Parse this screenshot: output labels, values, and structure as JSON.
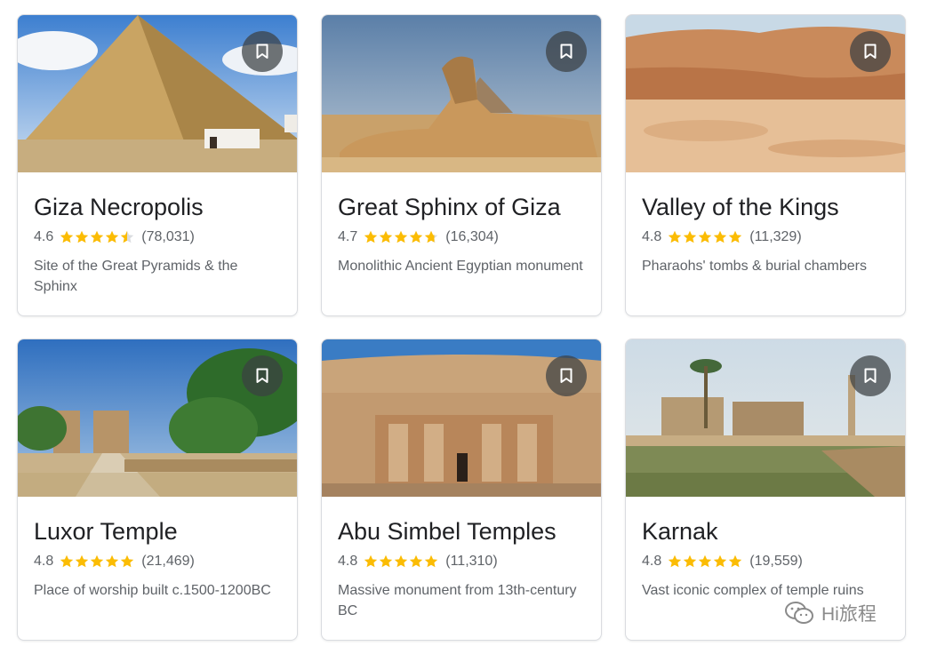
{
  "cards": [
    {
      "title": "Giza Necropolis",
      "rating": "4.6",
      "reviews": "(78,031)",
      "description": "Site of the Great Pyramids & the Sphinx",
      "stars": [
        1,
        1,
        1,
        1,
        0.5
      ]
    },
    {
      "title": "Great Sphinx of Giza",
      "rating": "4.7",
      "reviews": "(16,304)",
      "description": "Monolithic Ancient Egyptian monument",
      "stars": [
        1,
        1,
        1,
        1,
        0.75
      ]
    },
    {
      "title": "Valley of the Kings",
      "rating": "4.8",
      "reviews": "(11,329)",
      "description": "Pharaohs' tombs & burial chambers",
      "stars": [
        1,
        1,
        1,
        1,
        1
      ]
    },
    {
      "title": "Luxor Temple",
      "rating": "4.8",
      "reviews": "(21,469)",
      "description": "Place of worship built c.1500-1200BC",
      "stars": [
        1,
        1,
        1,
        1,
        1
      ]
    },
    {
      "title": "Abu Simbel Temples",
      "rating": "4.8",
      "reviews": "(11,310)",
      "description": "Massive monument from 13th-century BC",
      "stars": [
        1,
        1,
        1,
        1,
        1
      ]
    },
    {
      "title": "Karnak",
      "rating": "4.8",
      "reviews": "(19,559)",
      "description": "Vast iconic complex of temple ruins",
      "stars": [
        1,
        1,
        1,
        1,
        1
      ]
    }
  ],
  "icons": {
    "bookmark": "bookmark-icon",
    "star": "star-icon",
    "watermark": "wechat-icon"
  },
  "colors": {
    "star": "#fbbc04",
    "star_empty": "#dadce0",
    "title": "#202124",
    "meta": "#5f6368"
  },
  "watermark": {
    "text": "Hi旅程"
  }
}
